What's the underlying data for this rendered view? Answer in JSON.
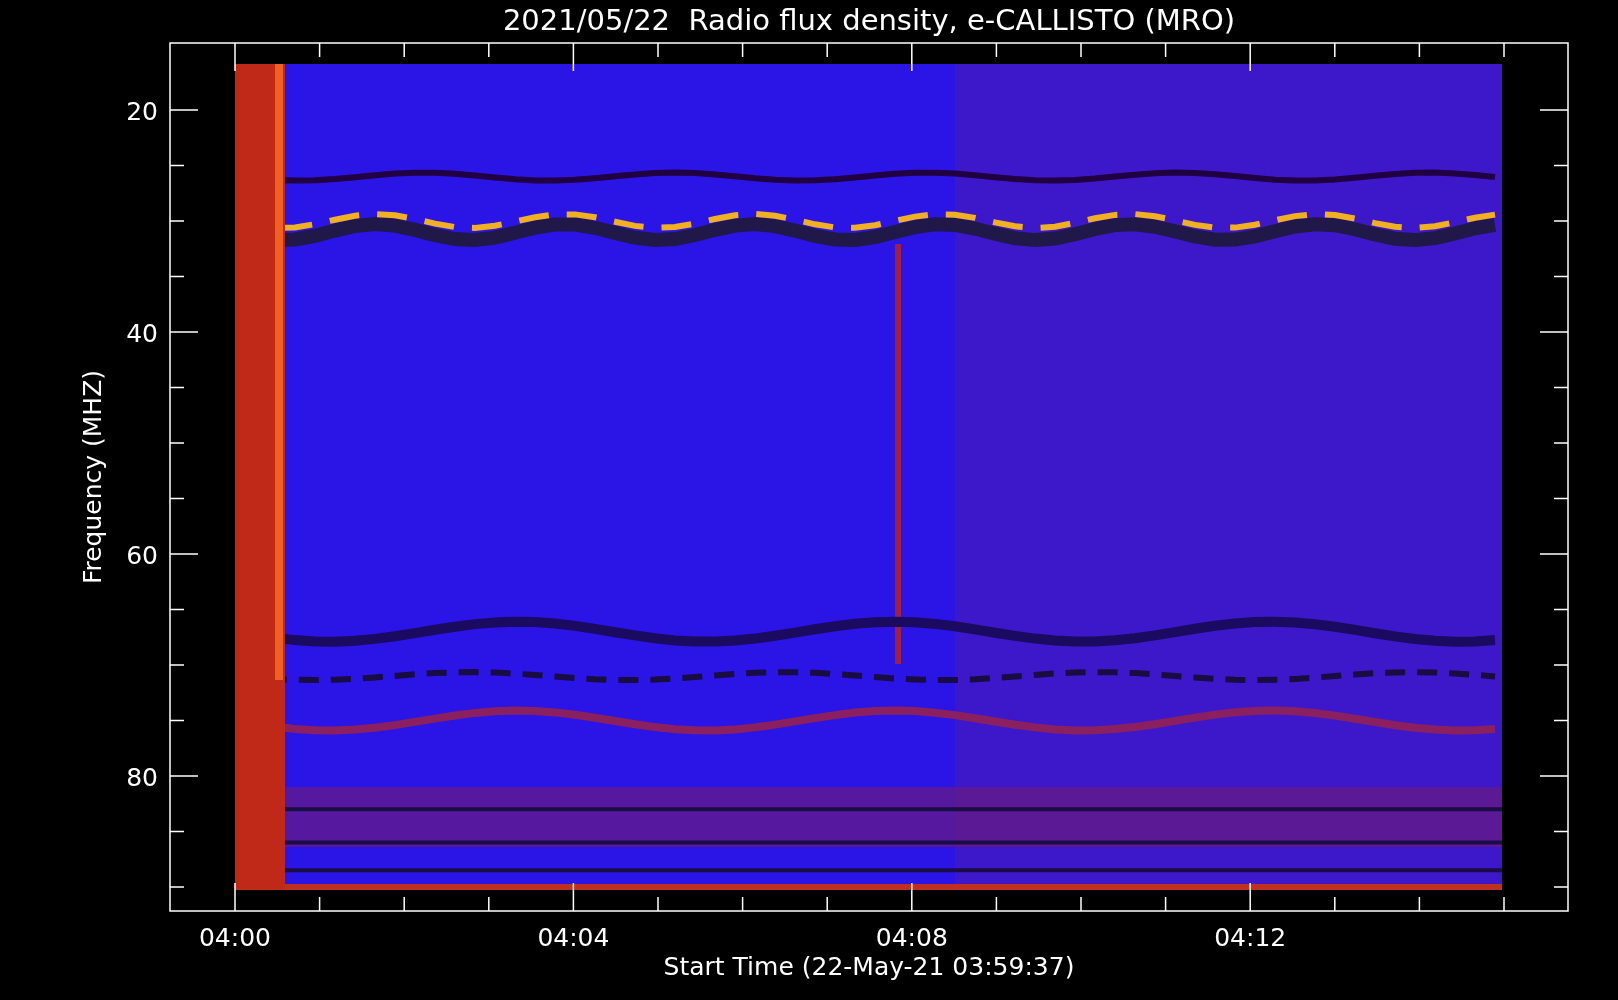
{
  "title": "2021/05/22  Radio flux density, e-CALLISTO (MRO)",
  "ylabel": "Frequency (MHZ)",
  "xlabel": "Start Time (22-May-21 03:59:37)",
  "yticks": [
    "20",
    "40",
    "60",
    "80"
  ],
  "xticks": [
    "04:00",
    "04:04",
    "04:08",
    "04:12"
  ]
}
